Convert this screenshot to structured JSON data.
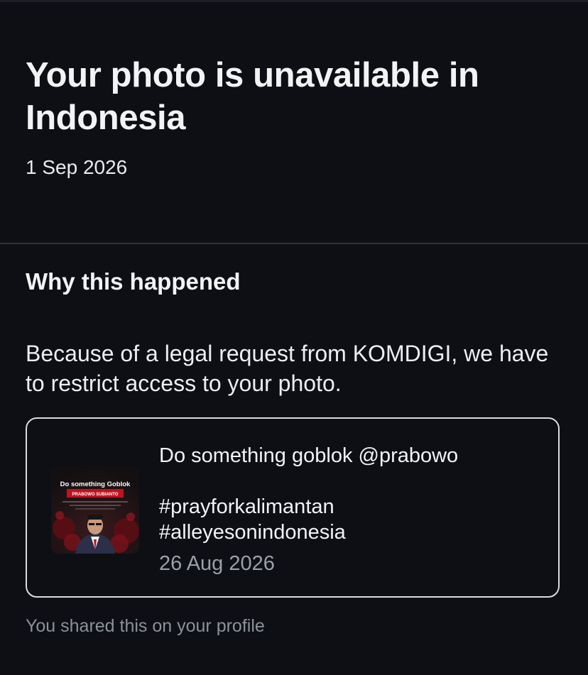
{
  "header": {
    "title": "Your photo is unavailable in Indonesia",
    "date": "1 Sep 2026"
  },
  "section": {
    "heading": "Why this happened",
    "reason": "Because of a legal request from KOMDIGI, we have to restrict access to your photo."
  },
  "post": {
    "caption_line_1": "Do something goblok @prabowo",
    "hashtag_1": "#prayforkalimantan",
    "hashtag_2": "#alleyesonindonesia",
    "date": "26 Aug 2026",
    "thumbnail": {
      "headline": "Do something Goblok",
      "name_banner": "PRABOWO SUBIANTO"
    }
  },
  "footer": {
    "note": "You shared this on your profile"
  },
  "colors": {
    "background": "#0d0f14",
    "text_primary": "#f2f3f5",
    "text_secondary": "#9ba0a8",
    "divider": "#2f333a",
    "card_border": "#d9dbde",
    "thumb_banner_red": "#c1121f"
  }
}
